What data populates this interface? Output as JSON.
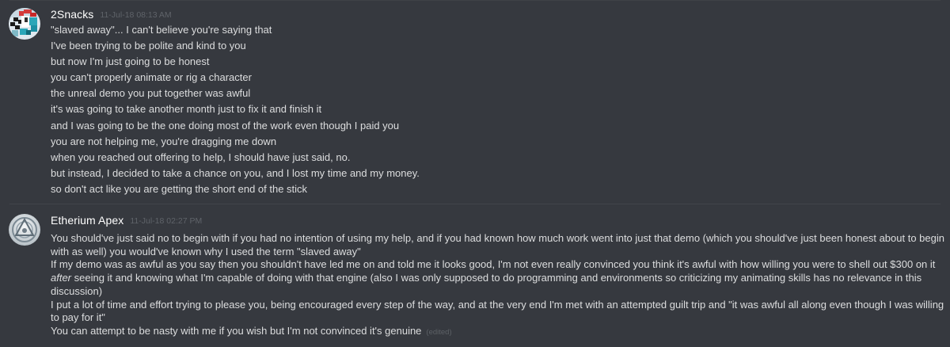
{
  "messages": [
    {
      "username": "2Snacks",
      "timestamp": "11-Jul-18 08:13 AM",
      "lines": [
        "\"slaved away\"... I can't believe you're saying that",
        "I've been trying to be polite and kind to you",
        "but now I'm just going to be honest",
        "you can't properly animate or rig a character",
        "the unreal demo you put together was awful",
        "it's was going to take another month just to fix it and finish it",
        "and I was going to be the one doing most of the work even though I paid you",
        "you are not helping me, you're dragging me down",
        "when you reached out offering to help, I should have just said, no.",
        "but instead, I decided to take a chance on you, and I lost my time and my money.",
        "so don't act like you are getting the short end of the stick"
      ]
    },
    {
      "username": "Etherium Apex",
      "timestamp": "11-Jul-18 02:27 PM",
      "lines": [
        "You should've just said no to begin with if you had no intention of using my help, and if you had known how much work went into just that demo (which you should've just been honest about to begin with as well) you would've known why I used the term \"slaved away\"",
        {
          "before": "If my demo was as awful as you say then you shouldn't have led me on and told me it looks good, I'm not even really convinced you think it's awful with how willing you were to shell out $300 on it ",
          "emphasis": "after",
          "after": " seeing it and knowing what I'm capable of doing with that engine (also I was only supposed to do programming and environments so criticizing my animating skills has no relevance in this discussion)"
        },
        "I put a lot of time and effort trying to please you, being encouraged every step of the way, and at the very end I'm met with an attempted guilt trip and \"it was awful all along even though I was willing to pay for it\"",
        "You can attempt to be nasty with me if you wish but I'm not convinced it's genuine"
      ],
      "edited_label": "(edited)"
    }
  ],
  "colors": {
    "background": "#36393f",
    "username": "#ffffff",
    "message_text": "#dcddde",
    "timestamp": "#5f6369",
    "divider": "#42454a"
  }
}
